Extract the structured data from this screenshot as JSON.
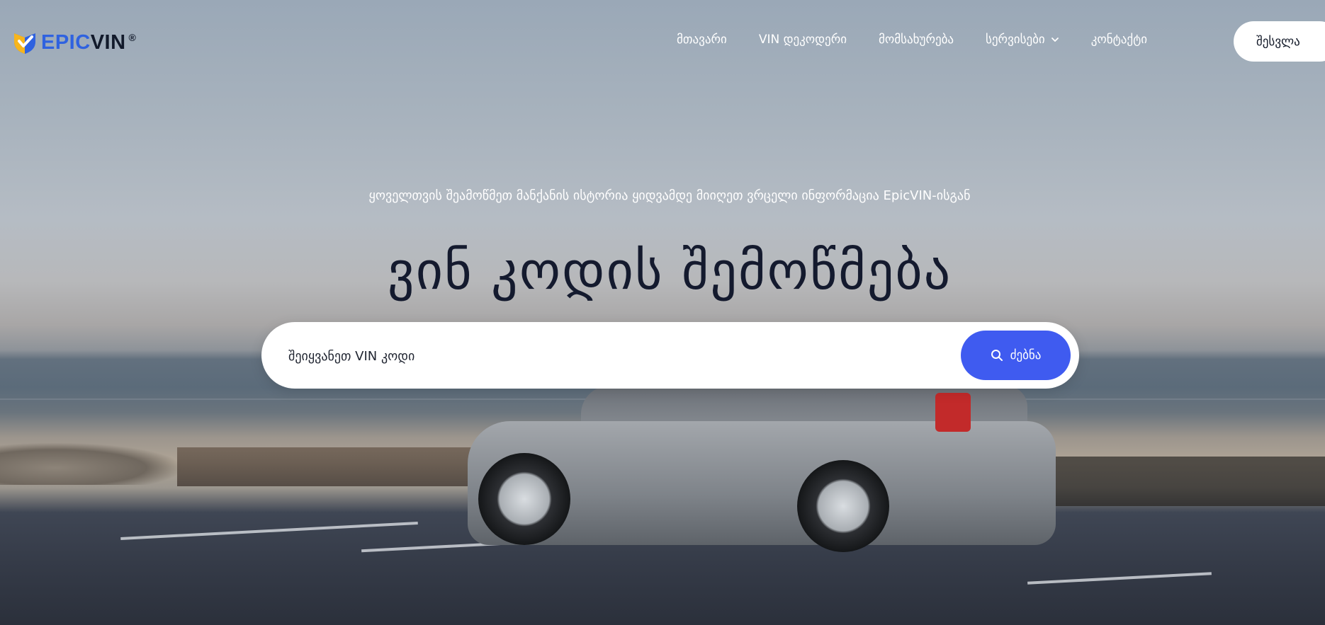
{
  "brand": {
    "name_part1": "EPIC",
    "name_part2": "VIN",
    "registered": "®",
    "colors": {
      "blue": "#2f62e0",
      "yellow": "#f7b51c",
      "dark": "#121a2b"
    }
  },
  "nav": {
    "items": [
      {
        "label": "მთავარი"
      },
      {
        "label": "VIN დეკოდერი"
      },
      {
        "label": "მომსახურება"
      },
      {
        "label": "სერვისები",
        "has_dropdown": true,
        "icon": "chevron-down-icon"
      },
      {
        "label": "კონტაქტი"
      }
    ],
    "login_label": "შესვლა"
  },
  "hero": {
    "tagline": "ყოველთვის შეამოწმეთ მანქანის ისტორია ყიდვამდე მიიღეთ ვრცელი ინფორმაცია EpicVIN-ისგან",
    "headline": "ვინ კოდის შემოწმება"
  },
  "search": {
    "placeholder": "შეიყვანეთ VIN კოდი",
    "value": "",
    "button_label": "ძებნა",
    "button_icon": "search-icon",
    "accent_color": "#3f5bf0"
  }
}
